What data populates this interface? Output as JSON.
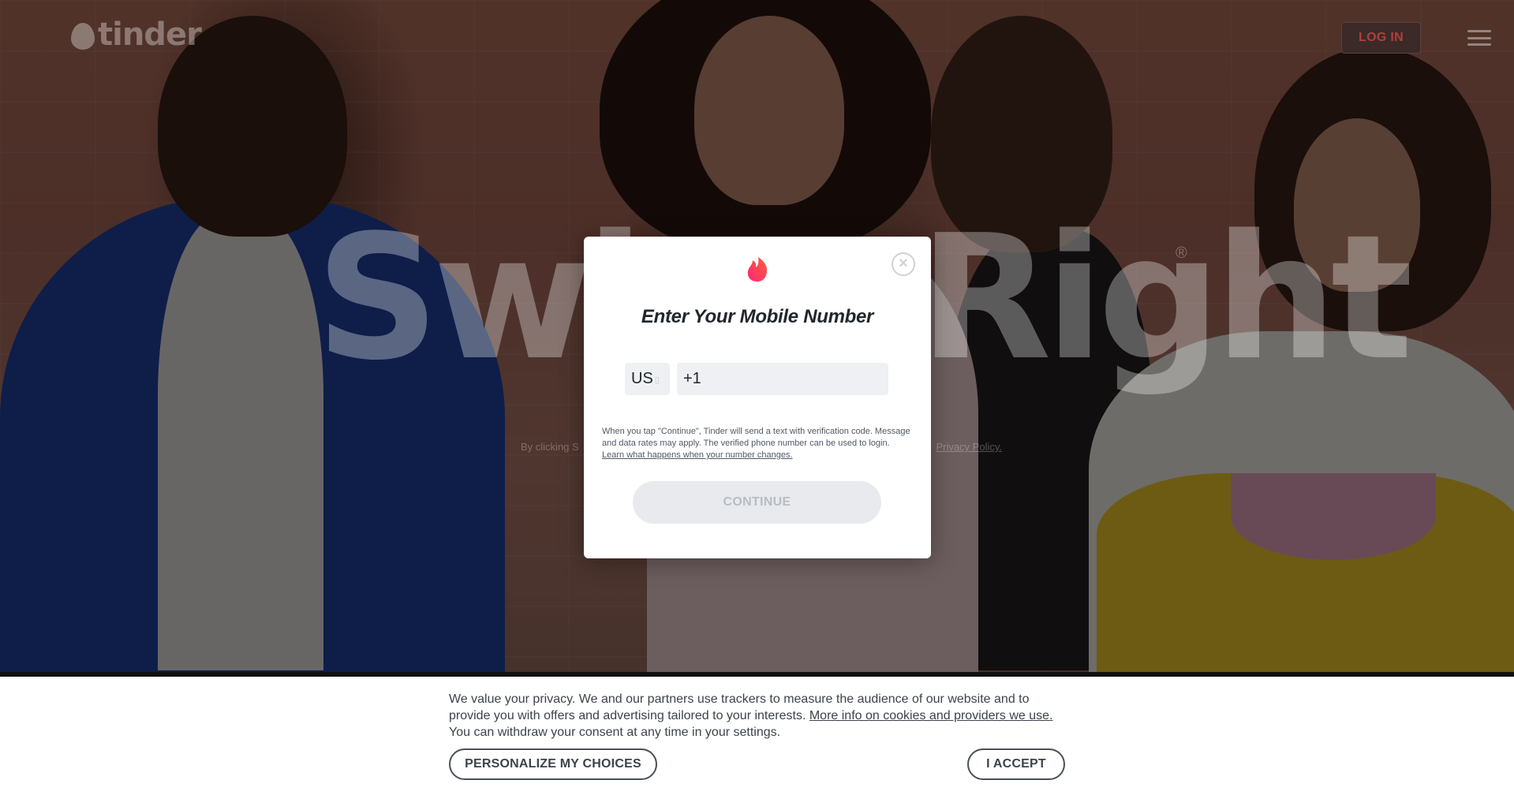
{
  "nav": {
    "logo_text": "tinder",
    "login_label": "LOG IN"
  },
  "hero": {
    "headline": "Swipe Right",
    "reg_mark": "®",
    "legal_left": "By clicking S",
    "legal_right": "Privacy Policy."
  },
  "modal": {
    "title": "Enter Your Mobile Number",
    "country_code": "US",
    "phone_value": "+1",
    "notice_text": "When you tap \"Continue\", Tinder will send a text with verification code. Message and data rates may apply. The verified phone number can be used to login.",
    "notice_link": "Learn what happens when your number changes.",
    "continue_label": "CONTINUE",
    "close_symbol": "×",
    "brand_color": "#fe3c72"
  },
  "cookie": {
    "text_1": "We value your privacy. We and our partners use trackers to measure the audience of our website and to provide you with offers and advertising tailored to your interests.",
    "link": "More info on cookies and providers we use.",
    "text_2": "You can withdraw your consent at any time in your settings.",
    "personalize_label": "PERSONALIZE MY CHOICES",
    "accept_label": "I ACCEPT"
  }
}
